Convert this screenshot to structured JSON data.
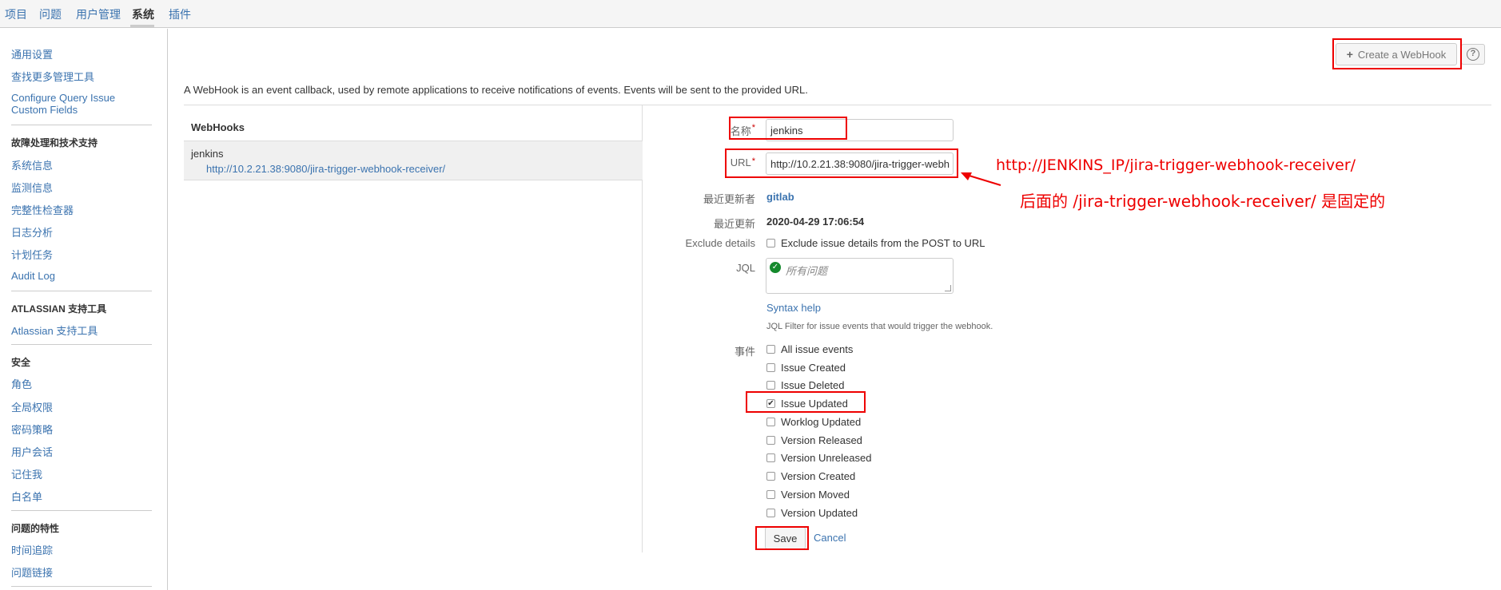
{
  "nav": {
    "tabs": [
      "项目",
      "问题",
      "用户管理",
      "系统",
      "插件"
    ],
    "active": "系统"
  },
  "sidebar": {
    "items": [
      "通用设置",
      "查找更多管理工具",
      "Configure Query Issue",
      "Custom Fields",
      "故障处理和技术支持",
      "系统信息",
      "监测信息",
      "完整性检查器",
      "日志分析",
      "计划任务",
      "Audit Log",
      "ATLASSIAN 支持工具",
      "Atlassian 支持工具",
      "安全",
      "角色",
      "全局权限",
      "密码策略",
      "用户会话",
      "记住我",
      "白名单",
      "问题的特性",
      "时间追踪",
      "问题链接"
    ]
  },
  "toolbar": {
    "create_label": "Create a WebHook",
    "help_label": "?"
  },
  "description": "A WebHook is an event callback, used by remote applications to receive notifications of events. Events will be sent to the provided URL.",
  "list": {
    "header": "WebHooks",
    "rows": [
      {
        "name": "jenkins",
        "url": "http://10.2.21.38:9080/jira-trigger-webhook-receiver/"
      }
    ]
  },
  "form": {
    "name_label": "名称",
    "name_value": "jenkins",
    "url_label": "URL",
    "url_value": "http://10.2.21.38:9080/jira-trigger-webh",
    "updater_label": "最近更新者",
    "updater_value": "gitlab",
    "updated_label": "最近更新",
    "updated_value": "2020-04-29 17:06:54",
    "exclude_label": "Exclude details",
    "exclude_text": "Exclude issue details from the POST to URL",
    "jql_label": "JQL",
    "jql_placeholder": "所有问题",
    "syntax_help": "Syntax help",
    "jql_hint": "JQL Filter for issue events that would trigger the webhook.",
    "events_label": "事件",
    "events": [
      {
        "label": "All issue events",
        "checked": false
      },
      {
        "label": "Issue Created",
        "checked": false
      },
      {
        "label": "Issue Deleted",
        "checked": false
      },
      {
        "label": "Issue Updated",
        "checked": true
      },
      {
        "label": "Worklog Updated",
        "checked": false
      },
      {
        "label": "Version Released",
        "checked": false
      },
      {
        "label": "Version Unreleased",
        "checked": false
      },
      {
        "label": "Version Created",
        "checked": false
      },
      {
        "label": "Version Moved",
        "checked": false
      },
      {
        "label": "Version Updated",
        "checked": false
      }
    ],
    "save_label": "Save",
    "cancel_label": "Cancel"
  },
  "annotations": {
    "line1": "http://JENKINS_IP/jira-trigger-webhook-receiver/",
    "line2": "后面的 /jira-trigger-webhook-receiver/ 是固定的"
  },
  "colors": {
    "link": "#3b73af",
    "annotation": "#ee0000",
    "jql_ok": "#14892c"
  }
}
